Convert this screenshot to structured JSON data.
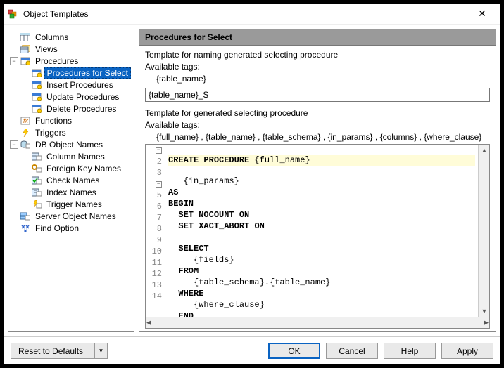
{
  "window": {
    "title": "Object Templates"
  },
  "tree": {
    "columns": "Columns",
    "views": "Views",
    "procedures": "Procedures",
    "procedures_select": "Procedures for Select",
    "insert_procedures": "Insert Procedures",
    "update_procedures": "Update Procedures",
    "delete_procedures": "Delete Procedures",
    "functions": "Functions",
    "triggers": "Triggers",
    "db_object_names": "DB Object Names",
    "column_names": "Column Names",
    "foreign_key_names": "Foreign Key Names",
    "check_names": "Check Names",
    "index_names": "Index Names",
    "trigger_names": "Trigger Names",
    "server_object_names": "Server Object Names",
    "find_option": "Find Option"
  },
  "panel": {
    "header": "Procedures for Select",
    "naming_caption": "Template for naming generated selecting procedure",
    "available_tags_label": "Available tags:",
    "naming_tags": "{table_name}",
    "naming_value": "{table_name}_S",
    "body_caption": "Template for generated selecting procedure",
    "body_tags": "{full_name} , {table_name} , {table_schema} , {in_params} , {columns} , {where_clause}"
  },
  "code": {
    "lines": [
      "CREATE PROCEDURE {full_name}",
      "   {in_params}",
      "AS",
      "BEGIN",
      "  SET NOCOUNT ON",
      "  SET XACT_ABORT ON",
      "",
      "  SELECT",
      "     {fields}",
      "  FROM",
      "     {table_schema}.{table_name}",
      "  WHERE",
      "     {where_clause}",
      "  END"
    ]
  },
  "buttons": {
    "reset": "Reset to Defaults",
    "ok": "OK",
    "cancel": "Cancel",
    "help": "Help",
    "apply": "Apply"
  }
}
